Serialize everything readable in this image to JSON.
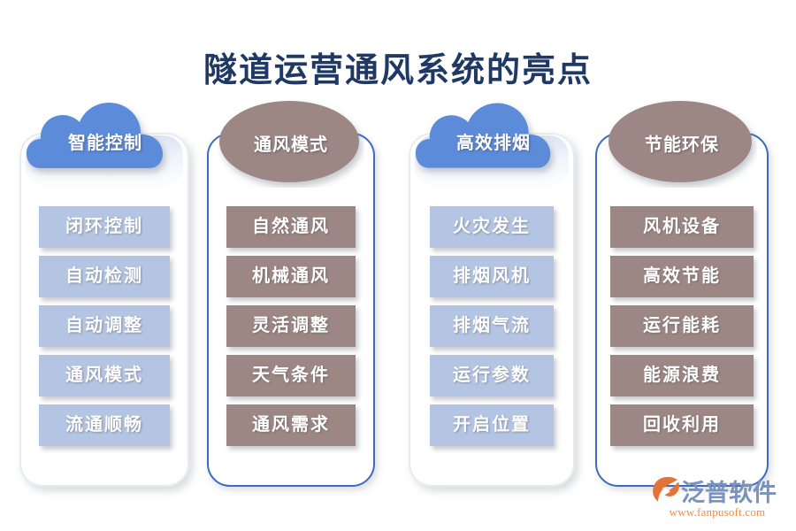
{
  "page": {
    "title": "隧道运营通风系统的亮点",
    "background_color": "#ffffff",
    "title_color": "#1f3864"
  },
  "columns": [
    {
      "id": "col-1",
      "header": "智能控制",
      "header_shape": "cloud",
      "header_color": "#5b8bd9",
      "card_style": "plain",
      "chip_color": "#b4c5e3",
      "items": [
        "闭环控制",
        "自动检测",
        "自动调整",
        "通风模式",
        "流通顺畅"
      ]
    },
    {
      "id": "col-2",
      "header": "通风模式",
      "header_shape": "ellipse",
      "header_color": "#9d8784",
      "card_style": "outlined",
      "card_border_color": "#3a6cbf",
      "chip_color": "#9d8784",
      "items": [
        "自然通风",
        "机械通风",
        "灵活调整",
        "天气条件",
        "通风需求"
      ]
    },
    {
      "id": "col-3",
      "header": "高效排烟",
      "header_shape": "cloud",
      "header_color": "#5b8bd9",
      "card_style": "plain",
      "chip_color": "#b4c5e3",
      "items": [
        "火灾发生",
        "排烟风机",
        "排烟气流",
        "运行参数",
        "开启位置"
      ]
    },
    {
      "id": "col-4",
      "header": "节能环保",
      "header_shape": "ellipse",
      "header_color": "#9d8784",
      "card_style": "outlined",
      "card_border_color": "#3a6cbf",
      "chip_color": "#9d8784",
      "items": [
        "风机设备",
        "高效节能",
        "运行能耗",
        "能源浪费",
        "回收利用"
      ]
    }
  ],
  "logo": {
    "brand": "泛普软件",
    "url": "www.fanpusoft.com",
    "brand_color": "#7a93bd",
    "url_color": "#e98c4a",
    "mark_color": "#e2733a"
  }
}
